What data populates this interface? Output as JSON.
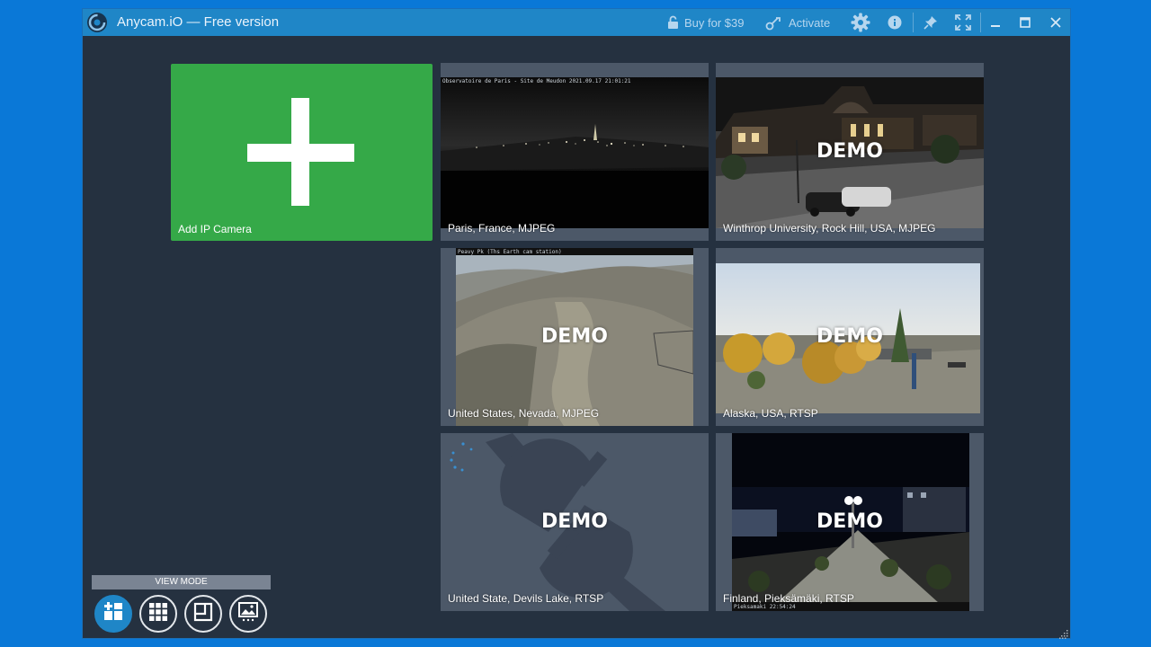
{
  "window": {
    "title": "Anycam.iO — Free version"
  },
  "toolbar": {
    "buy_label": "Buy for $39",
    "activate_label": "Activate",
    "icons": [
      "lock-icon",
      "activate-key-icon",
      "gear-icon",
      "info-icon",
      "pin-icon",
      "fullscreen-icon",
      "minimize-icon",
      "maximize-icon",
      "close-icon"
    ]
  },
  "add_camera": {
    "label": "Add IP Camera"
  },
  "cameras": [
    {
      "caption": "Paris, France, MJPEG",
      "demo": "",
      "osd": "Observatoire de Paris - Site de Meudon 2021.09.17 21:01:21"
    },
    {
      "caption": "Winthrop University, Rock Hill, USA, MJPEG",
      "demo": "DEMO"
    },
    {
      "caption": "United States, Nevada, MJPEG",
      "demo": "DEMO",
      "osd": "Peavy Pk (Ths Earth cam station)"
    },
    {
      "caption": "Alaska, USA, RTSP",
      "demo": "DEMO"
    },
    {
      "caption": "United State, Devils Lake, RTSP",
      "demo": "DEMO"
    },
    {
      "caption": "Finland, Pieksämäki, RTSP",
      "demo": "DEMO",
      "osd": "Pieksamaki 22:54:24"
    }
  ],
  "view_mode": {
    "label": "VIEW MODE",
    "buttons": [
      "add-grid-icon",
      "grid-icon",
      "single-view-icon",
      "gallery-icon"
    ],
    "active_index": 0
  },
  "colors": {
    "titlebar": "#1f86c7",
    "window_bg": "#253140",
    "add_tile": "#35a948",
    "tile_bg": "#4c5868"
  }
}
